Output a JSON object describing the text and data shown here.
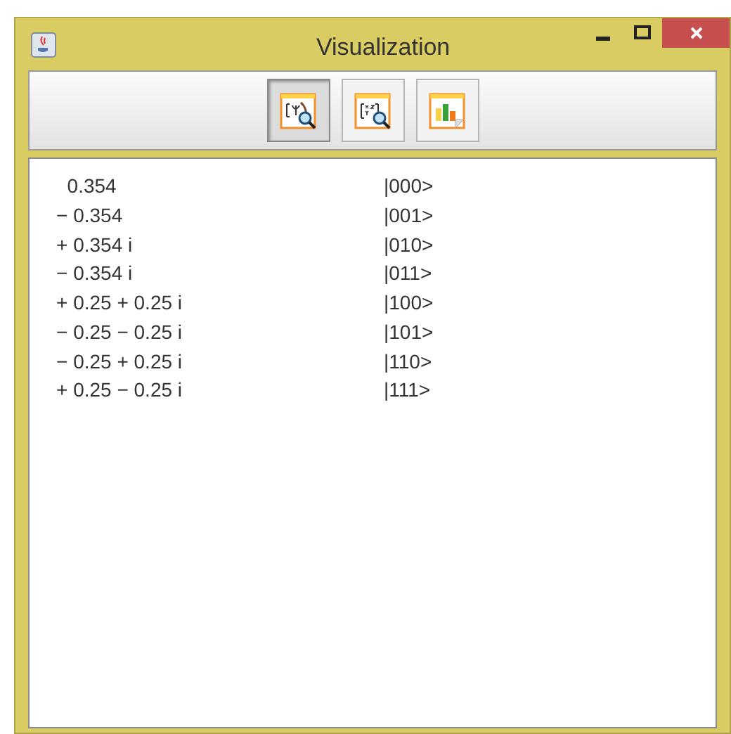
{
  "window": {
    "title": "Visualization"
  },
  "toolbar": {
    "buttons": [
      {
        "kind": "state",
        "selected": true
      },
      {
        "kind": "matrix",
        "selected": false
      },
      {
        "kind": "chart",
        "selected": false
      }
    ]
  },
  "rows": [
    {
      "amplitude": "  0.354",
      "basis": "|000>"
    },
    {
      "amplitude": "− 0.354",
      "basis": "|001>"
    },
    {
      "amplitude": "+ 0.354 i",
      "basis": "|010>"
    },
    {
      "amplitude": "− 0.354 i",
      "basis": "|011>"
    },
    {
      "amplitude": "+ 0.25 + 0.25 i",
      "basis": "|100>"
    },
    {
      "amplitude": "− 0.25 − 0.25 i",
      "basis": "|101>"
    },
    {
      "amplitude": "− 0.25 + 0.25 i",
      "basis": "|110>"
    },
    {
      "amplitude": "+ 0.25 − 0.25 i",
      "basis": "|111>"
    }
  ]
}
